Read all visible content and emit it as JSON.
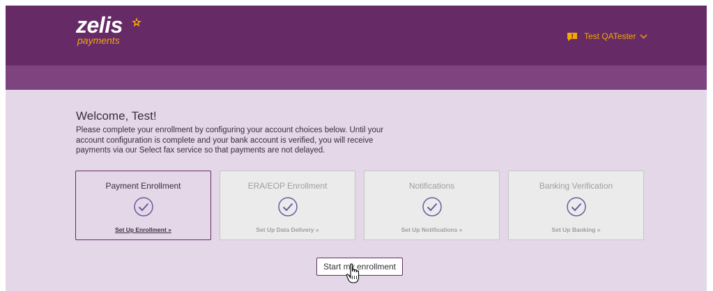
{
  "brand": {
    "name": "zelis",
    "tagline": "payments",
    "header_color": "#662a67",
    "subbar_color": "#7d4480",
    "accent_color": "#f2a900",
    "page_bg": "#e3d7e8"
  },
  "header": {
    "user_name": "Test QATester",
    "message_icon": "message-alert-icon",
    "dropdown_icon": "chevron-down-icon"
  },
  "welcome": {
    "title": "Welcome, Test!",
    "body": "Please complete your enrollment by configuring your account choices below. Until your account configuration is complete and your bank account is verified, you will receive payments via our Select fax service so that payments are not delayed."
  },
  "cards": [
    {
      "title": "Payment Enrollment",
      "link": "Set Up Enrollment »",
      "active": true
    },
    {
      "title": "ERA/EOP Enrollment",
      "link": "Set Up Data Delivery »",
      "active": false
    },
    {
      "title": "Notifications",
      "link": "Set Up Notifications »",
      "active": false
    },
    {
      "title": "Banking Verification",
      "link": "Set Up Banking »",
      "active": false
    }
  ],
  "start_button": "Start my enrollment"
}
